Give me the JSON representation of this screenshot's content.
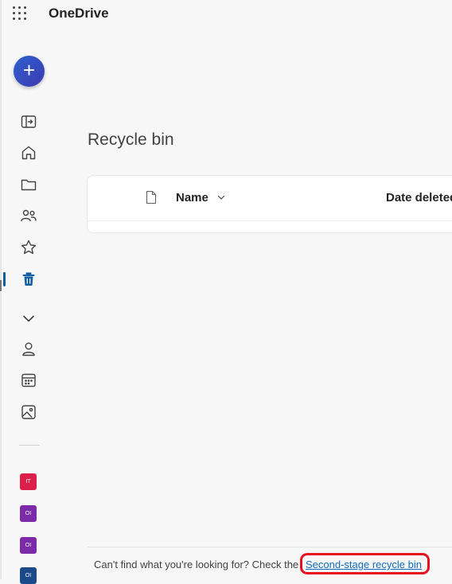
{
  "app": {
    "title": "OneDrive"
  },
  "rail": {
    "create": {
      "symbol": "+",
      "icon": "plus-icon"
    },
    "items": [
      {
        "id": "collapse",
        "icon": "panel-expand-icon"
      },
      {
        "id": "home",
        "icon": "home-icon"
      },
      {
        "id": "my-files",
        "icon": "folder-icon"
      },
      {
        "id": "shared",
        "icon": "people-icon"
      },
      {
        "id": "favorites",
        "icon": "star-icon"
      },
      {
        "id": "recycle-bin",
        "icon": "trash-icon",
        "active": true
      },
      {
        "id": "more",
        "icon": "chevron-down-icon"
      },
      {
        "id": "people",
        "icon": "person-icon"
      },
      {
        "id": "meetings",
        "icon": "calendar-icon"
      },
      {
        "id": "photos",
        "icon": "image-icon"
      }
    ],
    "apps": [
      {
        "label": "IT",
        "color": "#dc1e4a"
      },
      {
        "label": "OI",
        "color": "#7b2aa8"
      },
      {
        "label": "OI",
        "color": "#7b2aa8"
      },
      {
        "label": "OI",
        "color": "#1b4a8a"
      }
    ]
  },
  "main": {
    "title": "Recycle bin",
    "columns": {
      "name": "Name",
      "date_deleted": "Date deleted"
    }
  },
  "footer": {
    "message": "Can't find what you're looking for? Check the",
    "link": "Second-stage recycle bin"
  },
  "colors": {
    "accent": "#0f6cbd",
    "highlight": "#e8101e"
  }
}
